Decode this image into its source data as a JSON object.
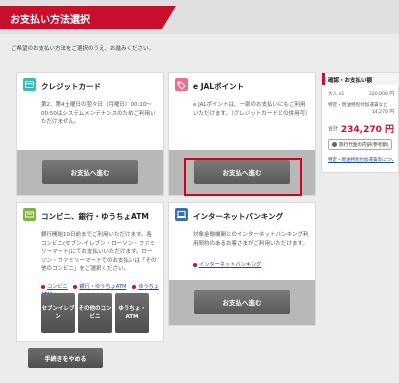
{
  "header": {
    "title": "お支払い方法選択"
  },
  "intro_text": "ご希望のお支払い方法をご選択のうえ、お進みください。",
  "colors": {
    "brand": "#c8102e",
    "card_icon_teal": "#3fb8af",
    "card_icon_pink": "#e86f8a",
    "card_icon_green": "#7cb342",
    "card_icon_blue": "#3a6fb0"
  },
  "cards": {
    "credit": {
      "icon": "credit-card-icon",
      "title": "クレジットカード",
      "body": "第2、第4土曜日の翌々日（月曜日）00:10〜00:50はシステムメンテナンスのためご利用いただけません。",
      "button": "お支払へ進む"
    },
    "jal": {
      "icon": "jal-points-icon",
      "title": "e JALポイント",
      "body": "e JALポイントは、一部のお支払いにもご利用いただけます。（クレジットカードとの併用可）",
      "button": "お支払へ進む"
    },
    "konbini": {
      "icon": "atm-icon",
      "title": "コンビニ、銀行・ゆうちょATM",
      "body": "銀行開始10日前までご利用いただけます。各コンビニ(セブン-イレブン・ローソン・ファミリーマート)にてお支払いいただけます。ローソン・ファミリーマートでのお支払いは「その他のコンビニ」をご選択ください。",
      "links": [
        "コンビニ",
        "銀行・ゆうちょATM",
        "ゆうちょATM"
      ],
      "buttons": [
        "セブンイレブン",
        "その他のコンビニ",
        "ゆうちょ・ATM"
      ]
    },
    "netbanking": {
      "icon": "laptop-icon",
      "title": "インターネットバンキング",
      "body": "対象金融機関とのインターネットバンキング利用契約のあるお客さまがご利用いただけます。",
      "links": [
        "インターネットバンキング"
      ],
      "button": "お支払へ進む"
    }
  },
  "summary": {
    "title": "確認・お支払い額",
    "rows": [
      {
        "label": "大人 x1",
        "value": "220,000 円"
      },
      {
        "label": "特定・燃油特別付加運賃など",
        "value": "14,270 円"
      }
    ],
    "total_label": "合計",
    "total_value": "234,270 円",
    "detail_button": "旅行代金の内訳(参考額)",
    "note_link": "特定・燃油特別付加運賃等について"
  },
  "footer": {
    "cancel_button": "手続きをやめる"
  }
}
